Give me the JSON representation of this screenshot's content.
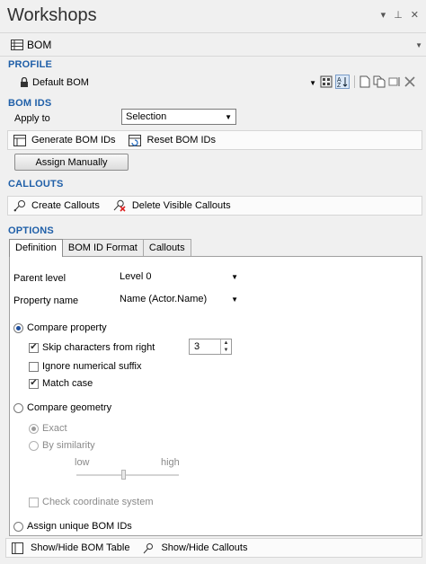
{
  "window": {
    "title": "Workshops",
    "controls": {
      "dropdown": "▾",
      "pin": "⊥",
      "close": "✕"
    }
  },
  "bom_selector": {
    "label": "BOM"
  },
  "profile": {
    "section_label": "PROFILE",
    "selected": "Default BOM"
  },
  "bom_ids": {
    "section_label": "BOM IDS",
    "apply_to_label": "Apply to",
    "apply_to_value": "Selection",
    "generate_label": "Generate BOM IDs",
    "reset_label": "Reset BOM IDs",
    "assign_label": "Assign Manually"
  },
  "callouts": {
    "section_label": "CALLOUTS",
    "create_label": "Create Callouts",
    "delete_label": "Delete Visible Callouts"
  },
  "options": {
    "section_label": "OPTIONS",
    "tabs": [
      "Definition",
      "BOM ID Format",
      "Callouts"
    ],
    "parent_level_label": "Parent level",
    "parent_level_value": "Level 0",
    "property_name_label": "Property name",
    "property_name_value": "Name (Actor.Name)",
    "compare_property_label": "Compare property",
    "skip_chars_label": "Skip characters from right",
    "skip_chars_value": "3",
    "ignore_suffix_label": "Ignore numerical suffix",
    "match_case_label": "Match case",
    "compare_geometry_label": "Compare geometry",
    "exact_label": "Exact",
    "similarity_label": "By similarity",
    "low_label": "low",
    "high_label": "high",
    "check_coord_label": "Check coordinate system",
    "assign_unique_label": "Assign unique BOM IDs"
  },
  "footer": {
    "show_hide_table_label": "Show/Hide BOM Table",
    "show_hide_callouts_label": "Show/Hide Callouts"
  },
  "colors": {
    "section": "#1f5fa8",
    "radio_dot": "#1e4f9e"
  }
}
